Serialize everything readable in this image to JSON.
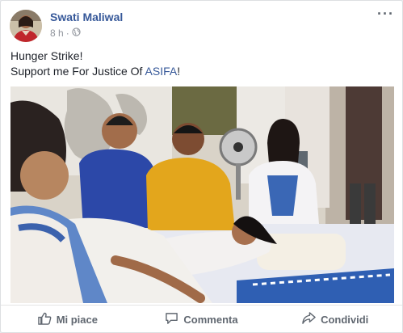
{
  "post": {
    "author": "Swati Maliwal",
    "time": "8 h",
    "separator": "·",
    "privacy_icon": "globe-icon",
    "menu_icon": "ellipsis-icon",
    "text_line1": "Hunger Strike!",
    "text_line2_prefix": "Support me For Justice Of ",
    "text_line2_highlight": "ASIFA",
    "text_line2_suffix": "!",
    "photo_icon": "group-photo"
  },
  "actions": [
    {
      "label": "Mi piace",
      "icon": "thumbs-up-icon"
    },
    {
      "label": "Commenta",
      "icon": "comment-icon"
    },
    {
      "label": "Condividi",
      "icon": "share-icon"
    }
  ],
  "colors": {
    "link": "#365899",
    "text": "#1d2129",
    "muted": "#90949c",
    "action": "#606770"
  }
}
